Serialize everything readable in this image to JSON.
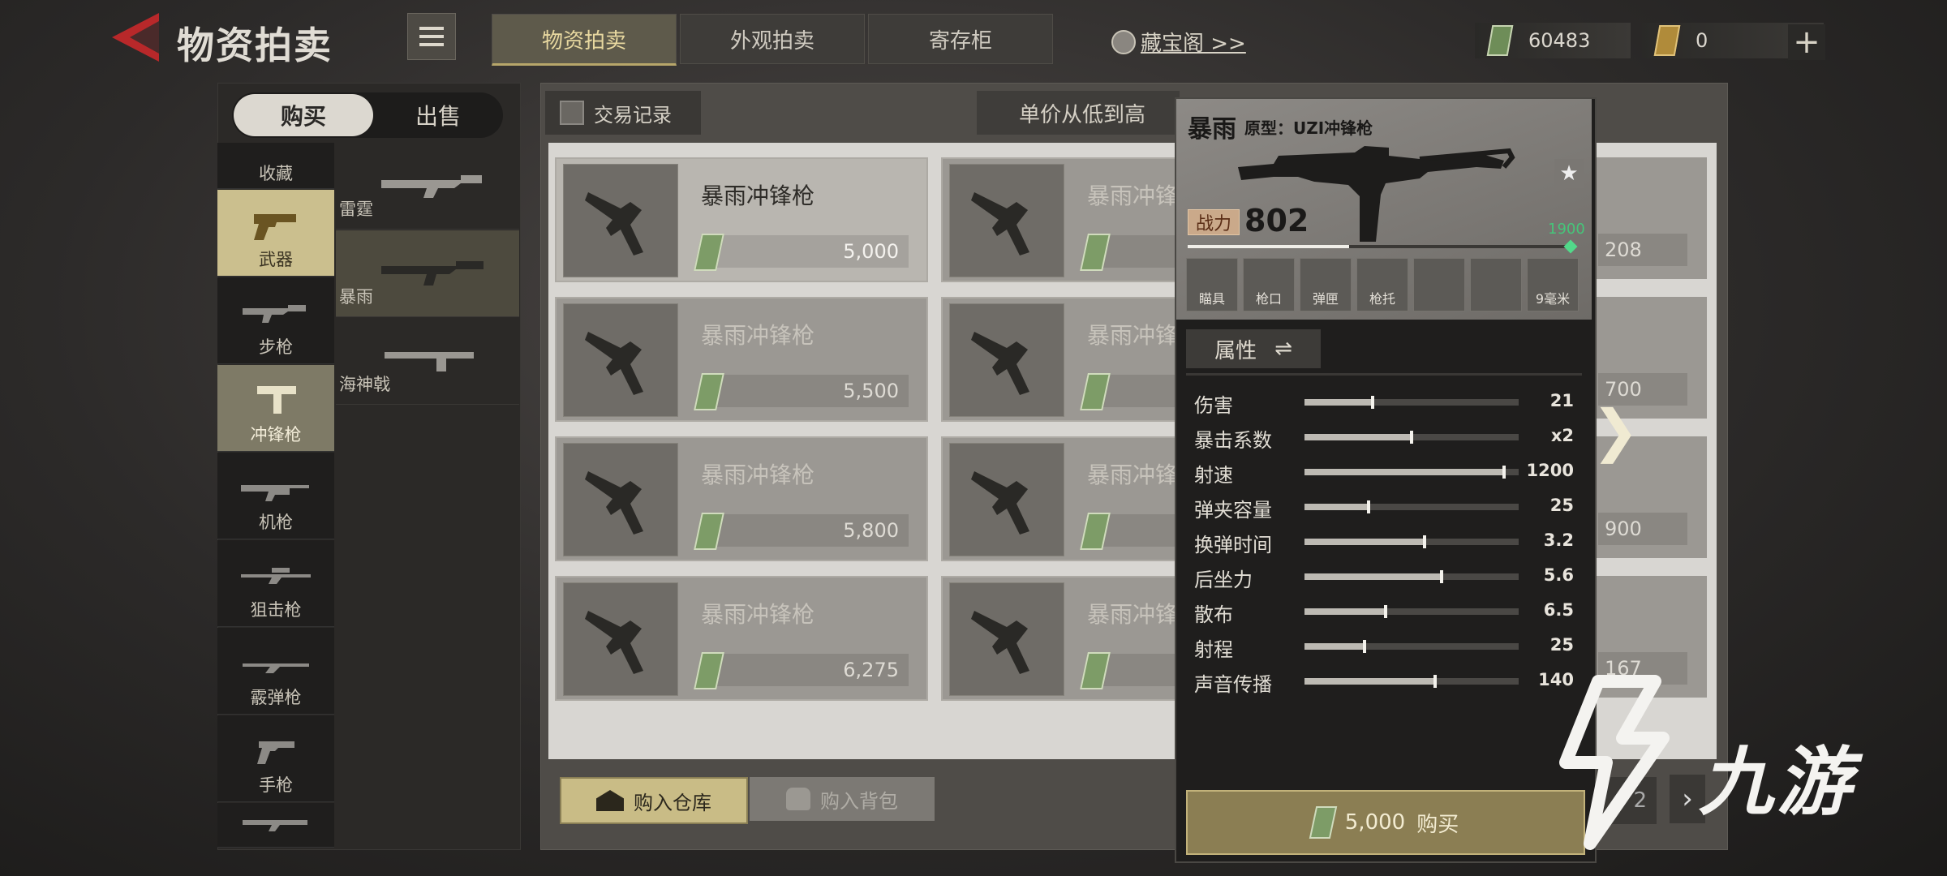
{
  "header": {
    "title": "物资拍卖",
    "tabs": [
      {
        "label": "物资拍卖",
        "active": true
      },
      {
        "label": "外观拍卖",
        "active": false
      },
      {
        "label": "寄存柜",
        "active": false
      }
    ],
    "treasure_link": "藏宝阁 >>",
    "cash": "60483",
    "gold": "0",
    "plus": "+"
  },
  "side": {
    "buy": "购买",
    "sell": "出售",
    "categories": [
      {
        "label": "收藏"
      },
      {
        "label": "武器"
      },
      {
        "label": "步枪"
      },
      {
        "label": "冲锋枪"
      },
      {
        "label": "机枪"
      },
      {
        "label": "狙击枪"
      },
      {
        "label": "霰弹枪"
      },
      {
        "label": "手枪"
      }
    ],
    "subitems": [
      {
        "label": "雷霆"
      },
      {
        "label": "暴雨"
      },
      {
        "label": "海神戟"
      }
    ]
  },
  "list": {
    "trade_record": "交易记录",
    "sort": "单价从低到高",
    "items": [
      {
        "name": "暴雨冲锋枪",
        "price": "5,000"
      },
      {
        "name": "暴雨冲锋枪",
        "price": "5,500"
      },
      {
        "name": "暴雨冲锋枪",
        "price": "5,800"
      },
      {
        "name": "暴雨冲锋枪",
        "price": "6,275"
      }
    ],
    "col2_name": "暴雨冲锋",
    "col3_partial": [
      "208",
      "700",
      "900",
      "167"
    ],
    "buy_warehouse": "购入仓库",
    "buy_bag": "购入背包",
    "page_next": "›",
    "next_arrow": "❯",
    "page_num": "2"
  },
  "detail": {
    "title": "暴雨",
    "prototype": "原型：UZI冲锋枪",
    "power_label": "战力",
    "power": "802",
    "power_max": "1900",
    "power_ratio": 0.42,
    "slots": [
      "瞄具",
      "枪口",
      "弹匣",
      "枪托",
      "",
      "",
      "9毫米"
    ],
    "attr_tab": "属性",
    "stats": [
      {
        "name": "伤害",
        "value": "21",
        "level": 0.32
      },
      {
        "name": "暴击系数",
        "value": "x2",
        "level": 0.5
      },
      {
        "name": "射速",
        "value": "1200",
        "level": 0.93
      },
      {
        "name": "弹夹容量",
        "value": "25",
        "level": 0.3
      },
      {
        "name": "换弹时间",
        "value": "3.2",
        "level": 0.56
      },
      {
        "name": "后坐力",
        "value": "5.6",
        "level": 0.64
      },
      {
        "name": "散布",
        "value": "6.5",
        "level": 0.38
      },
      {
        "name": "射程",
        "value": "25",
        "level": 0.28
      },
      {
        "name": "声音传播",
        "value": "140",
        "level": 0.61
      }
    ],
    "buy_price": "5,000",
    "buy_label": "购买"
  },
  "watermark": "九游"
}
